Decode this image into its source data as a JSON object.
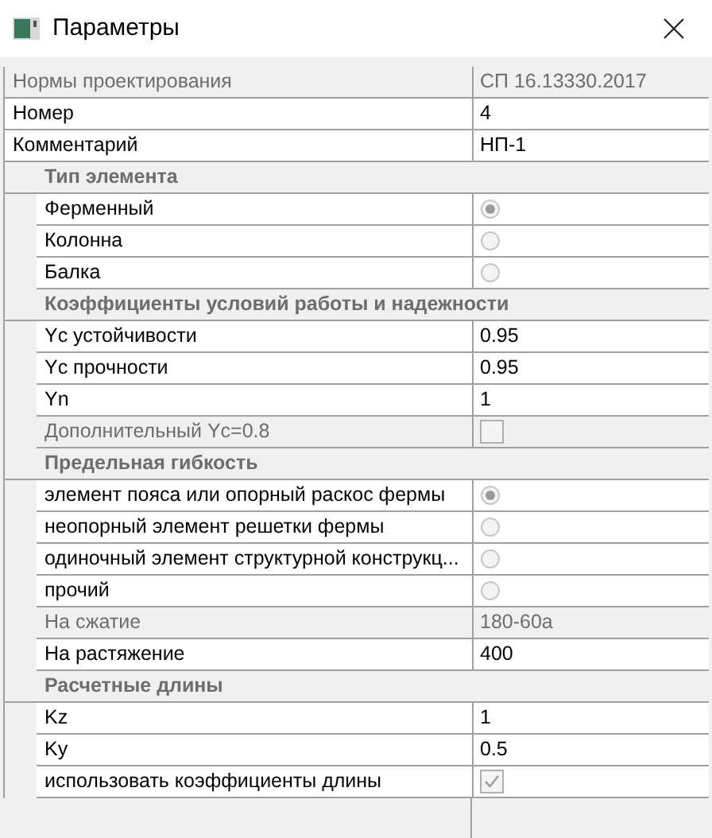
{
  "window": {
    "title": "Параметры"
  },
  "top_rows": [
    {
      "label": "Нормы проектирования",
      "value": "СП 16.13330.2017",
      "disabled": true
    },
    {
      "label": "Номер",
      "value": "4",
      "disabled": false
    },
    {
      "label": "Комментарий",
      "value": "НП-1",
      "disabled": false
    }
  ],
  "groups": [
    {
      "title": "Тип элемента",
      "rows": [
        {
          "kind": "radio",
          "label": "Ферменный",
          "selected": true,
          "disabled": false
        },
        {
          "kind": "radio",
          "label": "Колонна",
          "selected": false,
          "disabled": false
        },
        {
          "kind": "radio",
          "label": "Балка",
          "selected": false,
          "disabled": false
        }
      ]
    },
    {
      "title": "Коэффициенты условий работы и надежности",
      "rows": [
        {
          "kind": "text",
          "label": "Yc устойчивости",
          "value": "0.95",
          "disabled": false
        },
        {
          "kind": "text",
          "label": "Yc прочности",
          "value": "0.95",
          "disabled": false
        },
        {
          "kind": "text",
          "label": "Yn",
          "value": "1",
          "disabled": false
        },
        {
          "kind": "checkbox",
          "label": "Дополнительный Yc=0.8",
          "checked": false,
          "disabled": true
        }
      ]
    },
    {
      "title": "Предельная гибкость",
      "rows": [
        {
          "kind": "radio",
          "label": "элемент пояса или опорный раскос фермы",
          "selected": true,
          "disabled": false
        },
        {
          "kind": "radio",
          "label": "неопорный элемент решетки фермы",
          "selected": false,
          "disabled": false
        },
        {
          "kind": "radio",
          "label": "одиночный элемент структурной конструкц...",
          "selected": false,
          "disabled": false
        },
        {
          "kind": "radio",
          "label": "прочий",
          "selected": false,
          "disabled": false
        },
        {
          "kind": "text",
          "label": "На сжатие",
          "value": "180-60a",
          "disabled": true
        },
        {
          "kind": "text",
          "label": "На растяжение",
          "value": "400",
          "disabled": false
        }
      ]
    },
    {
      "title": "Расчетные длины",
      "rows": [
        {
          "kind": "text",
          "label": "Kz",
          "value": "1",
          "disabled": false
        },
        {
          "kind": "text",
          "label": "Ky",
          "value": "0.5",
          "disabled": false
        },
        {
          "kind": "checkbox",
          "label": "использовать коэффициенты длины",
          "checked": true,
          "disabled": false
        }
      ]
    }
  ]
}
